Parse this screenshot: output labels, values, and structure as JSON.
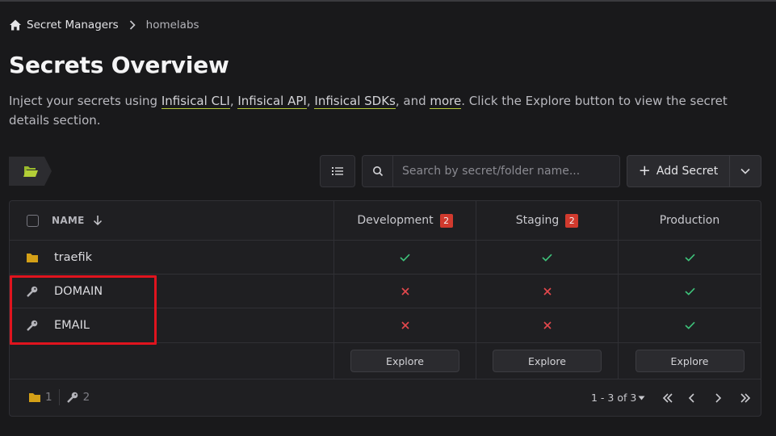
{
  "breadcrumb": {
    "items": [
      "Secret Managers",
      "homelabs"
    ]
  },
  "title": "Secrets Overview",
  "description": {
    "prefix": "Inject your secrets using ",
    "links": [
      "Infisical CLI",
      "Infisical API",
      "Infisical SDKs",
      "more"
    ],
    "sep1": ", ",
    "sep2": ", ",
    "sep3": ", and ",
    "suffix": ". Click the Explore button to view the secret details section."
  },
  "search": {
    "placeholder": "Search by secret/folder name..."
  },
  "add_secret": {
    "label": "Add Secret"
  },
  "table": {
    "name_header": "NAME",
    "environments": [
      {
        "name": "Development",
        "badge": "2"
      },
      {
        "name": "Staging",
        "badge": "2"
      },
      {
        "name": "Production",
        "badge": ""
      }
    ],
    "rows": [
      {
        "type": "folder",
        "name": "traefik",
        "status": [
          "check",
          "check",
          "check"
        ]
      },
      {
        "type": "secret",
        "name": "DOMAIN",
        "status": [
          "cross",
          "cross",
          "check"
        ]
      },
      {
        "type": "secret",
        "name": "EMAIL",
        "status": [
          "cross",
          "cross",
          "check"
        ]
      }
    ],
    "explore_label": "Explore"
  },
  "footer": {
    "folder_count": "1",
    "secret_count": "2",
    "pagination": "1 - 3 of 3"
  },
  "colors": {
    "check": "#3ec27a",
    "cross": "#e5484d",
    "folder": "#d4a017",
    "badge": "#d13a2e",
    "annotation": "#e0141e"
  }
}
